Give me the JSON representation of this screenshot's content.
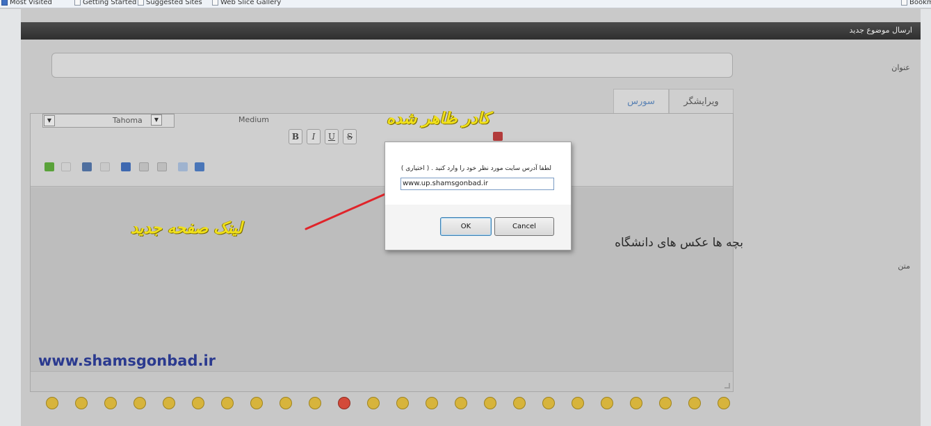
{
  "bookmarks": [
    {
      "label": "Most Visited",
      "icon": "bookmark-folder-icon"
    },
    {
      "label": "Getting Started",
      "icon": "page-icon"
    },
    {
      "label": "Suggested Sites",
      "icon": "page-icon"
    },
    {
      "label": "Web Slice Gallery",
      "icon": "page-icon"
    }
  ],
  "bookmarks_right": "Bookm",
  "panel": {
    "title": "ارسال موضوع جدید",
    "subject_label": "عنوان",
    "body_label": "متن"
  },
  "tabs": [
    {
      "label": "ویرایشگر",
      "active": false
    },
    {
      "label": "سورس",
      "active": true
    }
  ],
  "toolbar": {
    "font_family": "Tahoma",
    "font_size": "Medium",
    "bold": "B",
    "italic": "I",
    "underline": "U",
    "strike": "S"
  },
  "editor": {
    "content_text": "بچه ها عکس های دانشگاه"
  },
  "dialog": {
    "message": "لطفا آدرس سایت مورد نظر خود را وارد کنید . ( اختیاری )",
    "input_value": "www.up.shamsgonbad.ir",
    "ok_label": "OK",
    "cancel_label": "Cancel"
  },
  "annotations": {
    "dialog_label": "کادر ظاهر شده",
    "link_label": "لینک صفحه جدید"
  },
  "watermark": "www.shamsgonbad.ir",
  "colors": {
    "annotation": "#f0e01a",
    "pointer_line": "#e0242a",
    "watermark": "#2b3a8f",
    "header": "#333333"
  }
}
